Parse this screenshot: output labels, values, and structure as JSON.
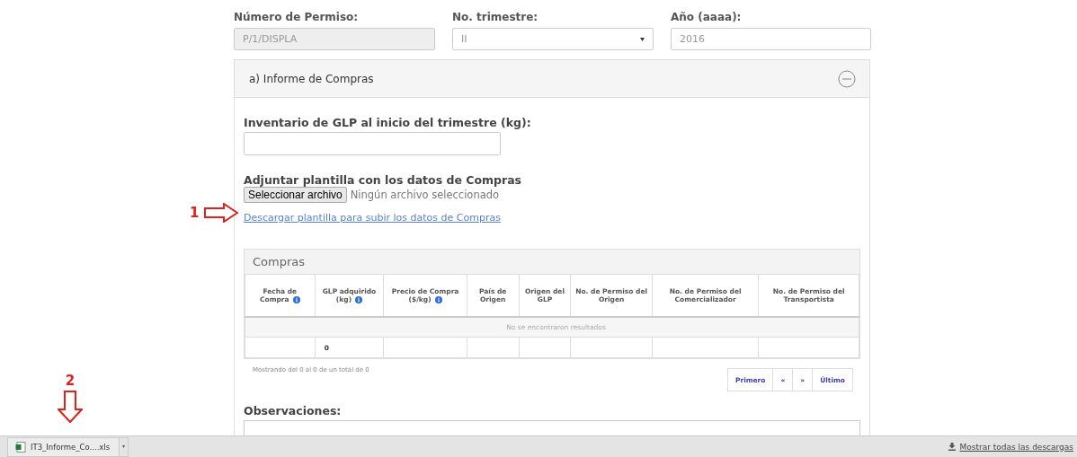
{
  "fields": [
    {
      "label": "Número de Permiso:",
      "kind": "text",
      "value": "P/1/DISPLA",
      "disabled": true
    },
    {
      "label": "No. trimestre:",
      "kind": "select",
      "value": "II",
      "disabled": false
    },
    {
      "label": "Año (aaaa):",
      "kind": "text",
      "value": "2016",
      "disabled": false
    }
  ],
  "panel": {
    "title": "a) Informe de Compras",
    "expanded": true,
    "inventory_label": "Inventario de GLP al inicio del trimestre (kg):",
    "attach_label": "Adjuntar plantilla con los datos de Compras",
    "file_button": "Seleccionar archivo",
    "file_status": "Ningún archivo seleccionado",
    "download_link": "Descargar plantilla para subir los datos de Compras",
    "table": {
      "title": "Compras",
      "columns": [
        {
          "label": "Fecha de Compra",
          "info": true
        },
        {
          "label": "GLP adquirido (kg)",
          "info": true
        },
        {
          "label": "Precio de Compra ($/kg)",
          "info": true
        },
        {
          "label": "País de Origen",
          "info": false
        },
        {
          "label": "Origen del GLP",
          "info": false
        },
        {
          "label": "No. de Permiso del Origen",
          "info": false
        },
        {
          "label": "No. de Permiso del Comercializador",
          "info": false
        },
        {
          "label": "No. de Permiso del Transportista",
          "info": false
        }
      ],
      "empty_message": "No se encontraron resultados",
      "totals": {
        "glp_acquired": "0"
      },
      "info": "Mostrando del 0 al 0 de un total de 0",
      "pagination": [
        "Primero",
        "«",
        "»",
        "Último"
      ]
    },
    "observations_label": "Observaciones:"
  },
  "annotations": [
    {
      "number": "1",
      "kind": "right"
    },
    {
      "number": "2",
      "kind": "down"
    }
  ],
  "download_bar": {
    "file": "IT3_Informe_Co....xls",
    "show_all": "Mostrar todas las descargas"
  }
}
